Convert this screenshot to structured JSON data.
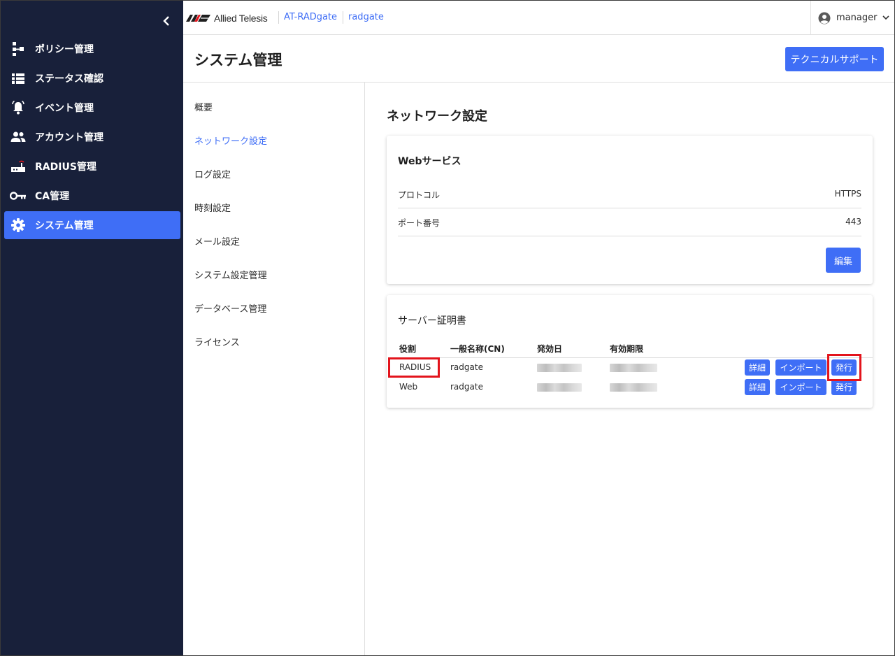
{
  "sidebar": {
    "collapse_icon": "chevron-left-icon",
    "items": [
      {
        "label": "ポリシー管理",
        "icon": "policy-tree-icon"
      },
      {
        "label": "ステータス確認",
        "icon": "list-icon"
      },
      {
        "label": "イベント管理",
        "icon": "bell-icon"
      },
      {
        "label": "アカウント管理",
        "icon": "people-icon"
      },
      {
        "label": "RADIUS管理",
        "icon": "router-icon"
      },
      {
        "label": "CA管理",
        "icon": "key-icon"
      },
      {
        "label": "システム管理",
        "icon": "gear-icon",
        "active": true
      }
    ]
  },
  "topbar": {
    "brand": "Allied Telesis",
    "crumbs": [
      "AT-RADgate",
      "radgate"
    ],
    "user": "manager"
  },
  "header": {
    "title": "システム管理",
    "support_button": "テクニカルサポート"
  },
  "submenu": {
    "items": [
      "概要",
      "ネットワーク設定",
      "ログ設定",
      "時刻設定",
      "メール設定",
      "システム設定管理",
      "データベース管理",
      "ライセンス"
    ],
    "active_index": 1
  },
  "content": {
    "title": "ネットワーク設定",
    "web_service": {
      "title": "Webサービス",
      "rows": [
        {
          "key": "プロトコル",
          "value": "HTTPS"
        },
        {
          "key": "ポート番号",
          "value": "443"
        }
      ],
      "edit_button": "編集"
    },
    "certificates": {
      "title": "サーバー証明書",
      "headers": [
        "役割",
        "一般名称(CN)",
        "発効日",
        "有効期限"
      ],
      "rows": [
        {
          "role": "RADIUS",
          "cn": "radgate",
          "highlighted": true
        },
        {
          "role": "Web",
          "cn": "radgate",
          "highlighted": false
        }
      ],
      "buttons": {
        "detail": "詳細",
        "import": "インポート",
        "issue": "発行"
      }
    }
  },
  "colors": {
    "sidebar_bg": "#18203a",
    "accent": "#3f6ef6",
    "highlight": "#e3141c"
  }
}
